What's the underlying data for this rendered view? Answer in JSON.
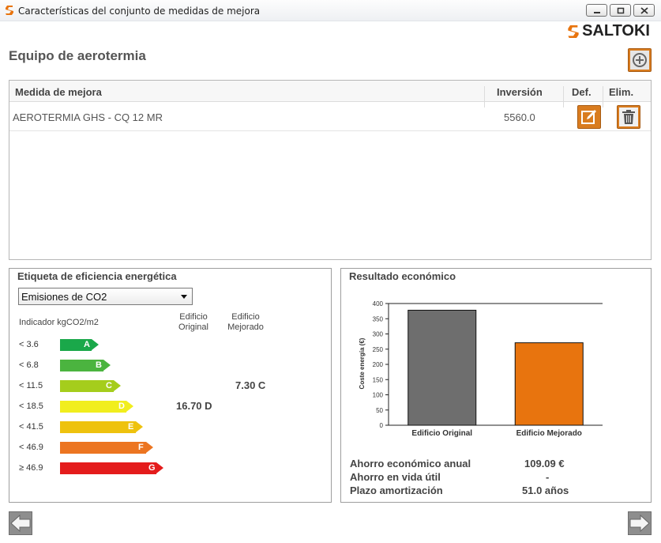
{
  "window": {
    "title": "Características del conjunto de medidas de mejora"
  },
  "logo": {
    "text": "SALTOKI"
  },
  "section": {
    "title": "Equipo de aerotermia"
  },
  "table": {
    "headers": {
      "measure": "Medida de mejora",
      "investment": "Inversión",
      "def": "Def.",
      "delete": "Elim."
    },
    "rows": [
      {
        "measure": "AEROTERMIA GHS - CQ 12 MR",
        "investment": "5560.0"
      }
    ]
  },
  "energy_label": {
    "title": "Etiqueta de eficiencia energética",
    "select_value": "Emisiones de CO2",
    "indicator": "Indicador kgCO2/m2",
    "col_original": [
      "Edificio",
      "Original"
    ],
    "col_improved": [
      "Edificio",
      "Mejorado"
    ],
    "ratings": [
      {
        "label": "< 3.6",
        "letter": "A",
        "color": "#1aa84a"
      },
      {
        "label": "< 6.8",
        "letter": "B",
        "color": "#4bb43f"
      },
      {
        "label": "< 11.5",
        "letter": "C",
        "color": "#a5cd1c"
      },
      {
        "label": "< 18.5",
        "letter": "D",
        "color": "#f1ee1e"
      },
      {
        "label": "< 41.5",
        "letter": "E",
        "color": "#eec20e"
      },
      {
        "label": "< 46.9",
        "letter": "F",
        "color": "#ec7521"
      },
      {
        "label": "≥ 46.9",
        "letter": "G",
        "color": "#e41c1c"
      }
    ],
    "original_value": "16.70 D",
    "improved_value": "7.30 C"
  },
  "economic": {
    "title": "Resultado económico",
    "annual_savings_label": "Ahorro económico anual",
    "annual_savings_value": "109.09 €",
    "lifetime_savings_label": "Ahorro en vida útil",
    "lifetime_savings_value": "-",
    "payback_label": "Plazo amortización",
    "payback_value": "51.0 años"
  },
  "chart_data": {
    "type": "bar",
    "categories": [
      "Edificio Original",
      "Edificio Mejorado"
    ],
    "values": [
      378,
      271
    ],
    "colors": [
      "#6e6e6e",
      "#e8740e"
    ],
    "ylabel": "Coste energía (€)",
    "ylim": [
      0,
      400
    ],
    "yticks": [
      0,
      50,
      100,
      150,
      200,
      250,
      300,
      350,
      400
    ]
  },
  "colors": {
    "accent": "#d97c1f"
  }
}
